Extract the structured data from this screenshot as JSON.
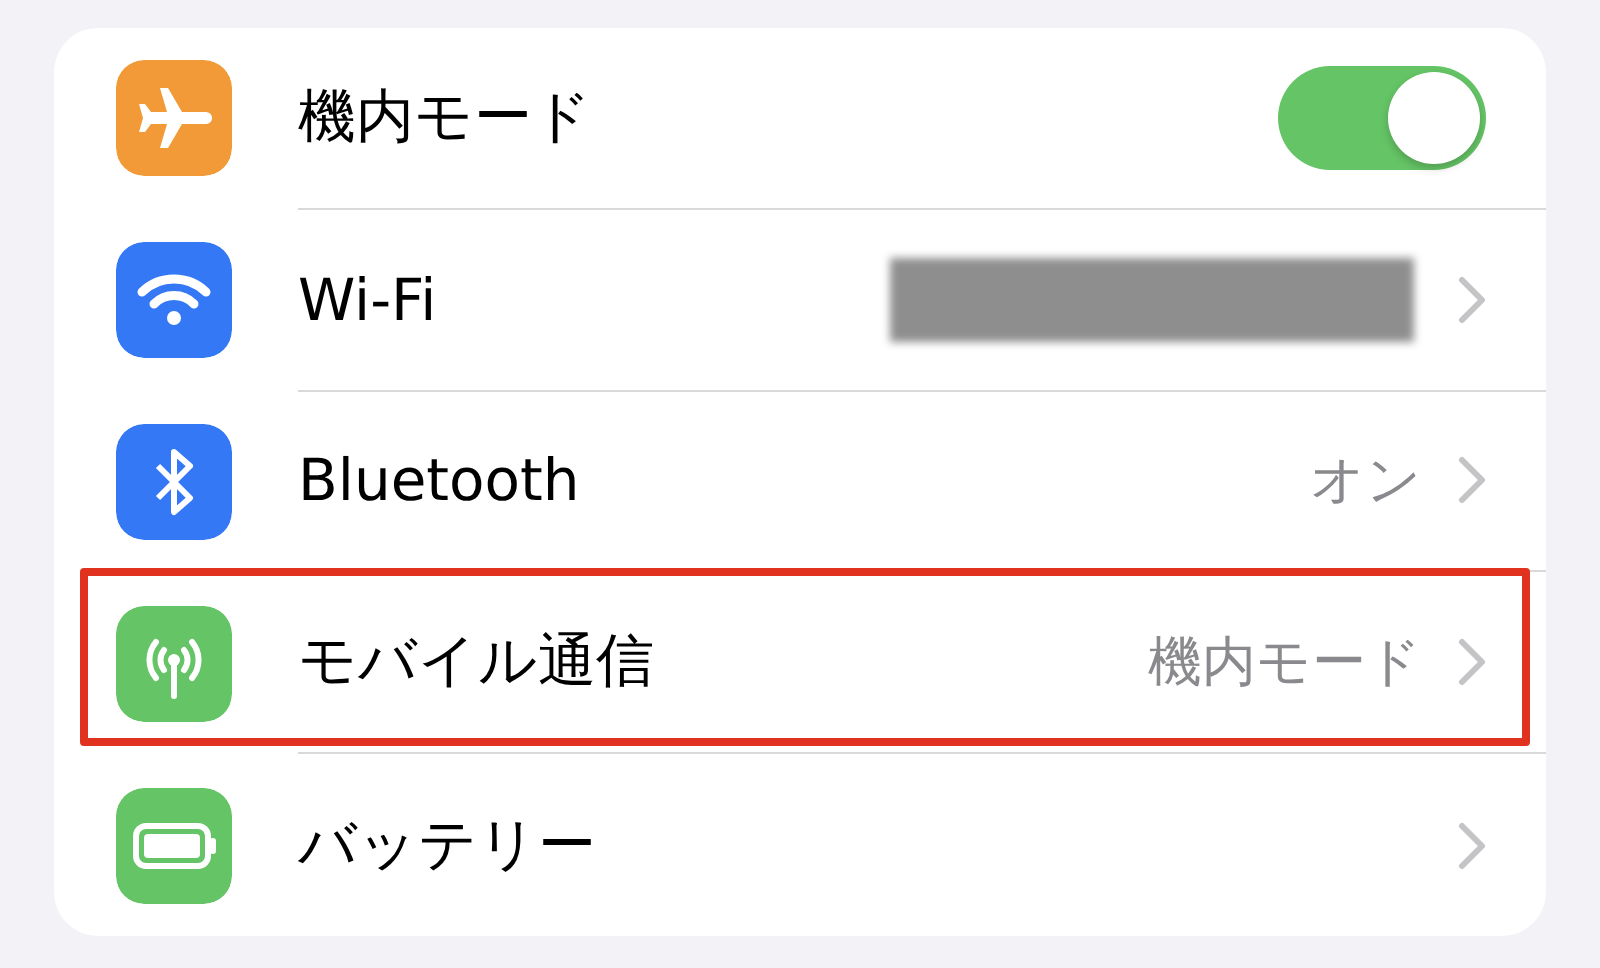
{
  "settings": [
    {
      "kind": "toggle",
      "label": "機内モード",
      "color": "#f19a37",
      "on": true,
      "highlighted": false
    },
    {
      "kind": "link",
      "label": "Wi-Fi",
      "color": "#3478f6",
      "value_redacted": true,
      "highlighted": false
    },
    {
      "kind": "link",
      "label": "Bluetooth",
      "color": "#3478f6",
      "value": "オン",
      "highlighted": false
    },
    {
      "kind": "link",
      "label": "モバイル通信",
      "color": "#65c466",
      "value": "機内モード",
      "highlighted": true
    },
    {
      "kind": "link",
      "label": "バッテリー",
      "color": "#65c466",
      "highlighted": false
    }
  ]
}
